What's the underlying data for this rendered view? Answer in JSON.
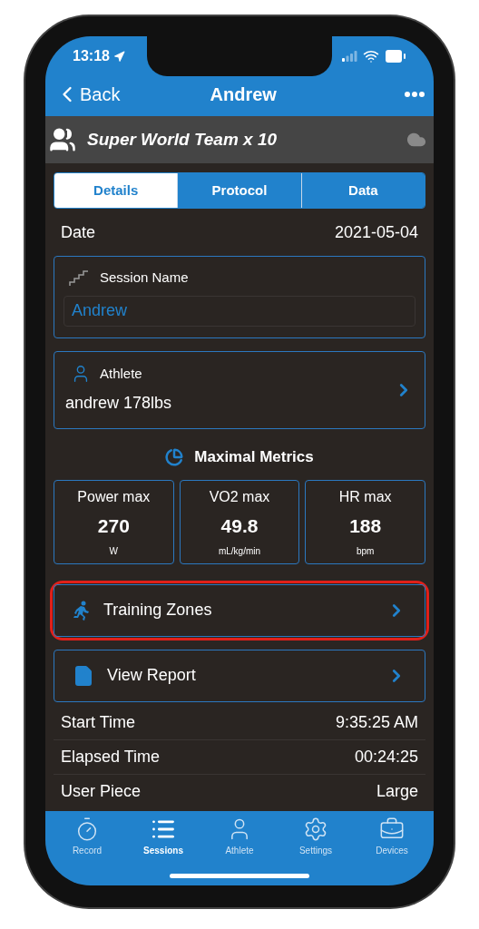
{
  "status_bar": {
    "time": "13:18"
  },
  "nav": {
    "back": "Back",
    "title": "Andrew"
  },
  "team_bar": {
    "name": "Super World Team x 10"
  },
  "tabs": [
    {
      "label": "Details",
      "selected": true
    },
    {
      "label": "Protocol",
      "selected": false
    },
    {
      "label": "Data",
      "selected": false
    }
  ],
  "date": {
    "label": "Date",
    "value": "2021-05-04"
  },
  "session_name": {
    "label": "Session Name",
    "value": "Andrew"
  },
  "athlete": {
    "label": "Athlete",
    "value": "andrew 178lbs"
  },
  "metrics": {
    "title": "Maximal Metrics",
    "items": [
      {
        "label": "Power max",
        "value": "270",
        "unit": "W"
      },
      {
        "label": "VO2 max",
        "value": "49.8",
        "unit": "mL/kg/min"
      },
      {
        "label": "HR max",
        "value": "188",
        "unit": "bpm"
      }
    ]
  },
  "links": [
    {
      "label": "Training Zones",
      "kind": "zones",
      "highlighted": true
    },
    {
      "label": "View Report",
      "kind": "report",
      "highlighted": false
    }
  ],
  "rows": [
    {
      "label": "Start Time",
      "value": "9:35:25 AM"
    },
    {
      "label": "Elapsed Time",
      "value": "00:24:25"
    },
    {
      "label": "User Piece",
      "value": "Large"
    }
  ],
  "tab_bar": [
    {
      "label": "Record",
      "kind": "record",
      "selected": false
    },
    {
      "label": "Sessions",
      "kind": "sessions",
      "selected": true
    },
    {
      "label": "Athlete",
      "kind": "athlete",
      "selected": false
    },
    {
      "label": "Settings",
      "kind": "settings",
      "selected": false
    },
    {
      "label": "Devices",
      "kind": "devices",
      "selected": false
    }
  ]
}
